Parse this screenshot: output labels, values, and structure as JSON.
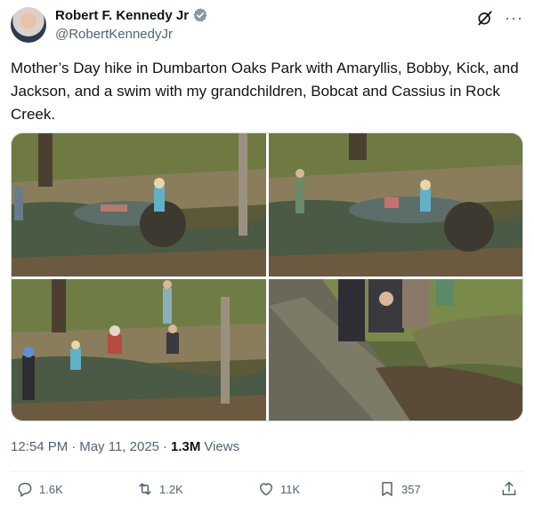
{
  "author": {
    "display_name": "Robert F. Kennedy Jr",
    "handle": "@RobertKennedyJr",
    "verified": true,
    "avatar_icon": "avatar"
  },
  "top_icons": [
    "grok-icon",
    "more-icon"
  ],
  "more_glyph": "···",
  "tweet": {
    "text": "Mother’s Day hike in Dumbarton Oaks Park with Amaryllis, Bobby, Kick, and Jackson, and a swim with my grandchildren, Bobcat and Cassius in Rock Creek."
  },
  "media": {
    "photo_count": 4
  },
  "meta": {
    "time": "12:54 PM",
    "separator1": "·",
    "date": "May 11, 2025",
    "separator2": "·",
    "views_count": "1.3M",
    "views_label": "Views"
  },
  "actions": {
    "reply": {
      "icon": "reply-icon",
      "count": "1.6K"
    },
    "retweet": {
      "icon": "retweet-icon",
      "count": "1.2K"
    },
    "like": {
      "icon": "heart-icon",
      "count": "11K"
    },
    "bookmark": {
      "icon": "bookmark-icon",
      "count": "357"
    },
    "share": {
      "icon": "share-icon"
    }
  },
  "colors": {
    "verified_badge": "#829aab",
    "secondary_text": "#536471",
    "primary_text": "#0f1419"
  }
}
